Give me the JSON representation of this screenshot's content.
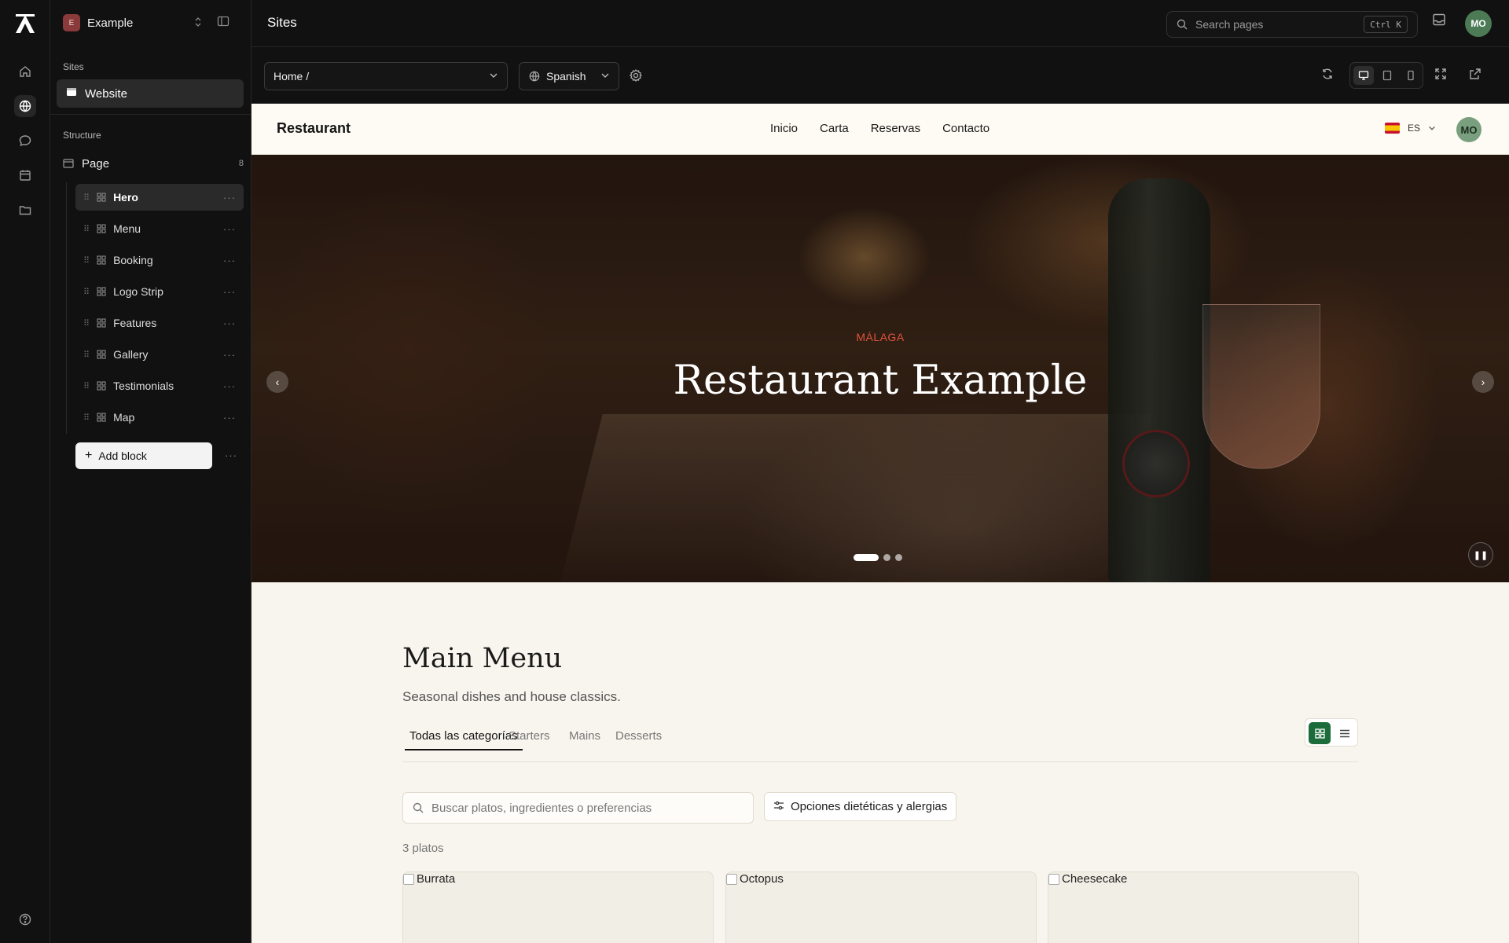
{
  "workspace": {
    "badge": "E",
    "name": "Example"
  },
  "sidebar": {
    "sites_label": "Sites",
    "site_item": "Website",
    "structure_label": "Structure",
    "page_label": "Page",
    "page_count": "8",
    "blocks": [
      {
        "label": "Hero",
        "active": true
      },
      {
        "label": "Menu"
      },
      {
        "label": "Booking"
      },
      {
        "label": "Logo Strip"
      },
      {
        "label": "Features"
      },
      {
        "label": "Gallery"
      },
      {
        "label": "Testimonials"
      },
      {
        "label": "Map"
      }
    ],
    "add_block": "Add block"
  },
  "header": {
    "title": "Sites",
    "search_placeholder": "Search pages",
    "search_shortcut": "Ctrl K",
    "avatar": "MO"
  },
  "toolbar": {
    "page_select": "Home /",
    "language_select": "Spanish",
    "active_device": "desktop"
  },
  "preview": {
    "nav": {
      "brand": "Restaurant",
      "links": [
        "Inicio",
        "Carta",
        "Reservas",
        "Contacto"
      ],
      "lang": "ES",
      "avatar": "MO"
    },
    "hero": {
      "kicker": "MÁLAGA",
      "title": "Restaurant Example",
      "slides": 3,
      "active_slide": 1
    },
    "menu": {
      "title": "Main Menu",
      "subtitle": "Seasonal dishes and house classics.",
      "tabs": [
        "Todas las categorías",
        "Starters",
        "Mains",
        "Desserts"
      ],
      "active_tab": "Todas las categorías",
      "active_view": "grid",
      "search_placeholder": "Buscar platos, ingredientes o preferencias",
      "diet_button": "Opciones dietéticas y alergias",
      "count": "3 platos",
      "items": [
        "Burrata",
        "Octopus",
        "Cheesecake"
      ]
    }
  },
  "colors": {
    "accent_green": "#1c6b3a",
    "kicker": "#e0533d",
    "avatar": "#4b7a55",
    "workspace_badge": "#8a3a3a"
  }
}
